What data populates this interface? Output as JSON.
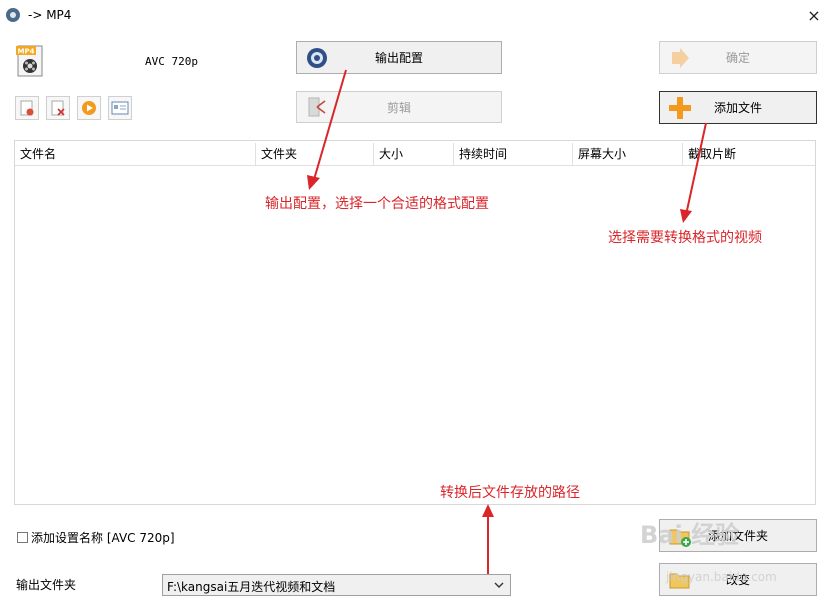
{
  "window": {
    "title": "-> MP4",
    "close": "×"
  },
  "preset": {
    "name": "AVC 720p"
  },
  "buttons": {
    "output_config": "输出配置",
    "ok": "确定",
    "edit": "剪辑",
    "add_file": "添加文件",
    "add_folder": "添加文件夹",
    "change": "改变"
  },
  "table": {
    "columns": [
      "文件名",
      "文件夹",
      "大小",
      "持续时间",
      "屏幕大小",
      "截取片断"
    ]
  },
  "annotations": {
    "output_config": "输出配置，选择一个合适的格式配置",
    "select_video": "选择需要转换格式的视频",
    "output_path": "转换后文件存放的路径"
  },
  "bottom": {
    "checkbox_label": "添加设置名称 [AVC 720p]",
    "output_folder_label": "输出文件夹",
    "output_folder_value": "F:\\kangsai五月迭代视频和文档"
  },
  "watermark": {
    "main": "Bai 经验",
    "sub": "jingyan.baidu.com"
  },
  "colors": {
    "annotation": "#d9262b",
    "plus_orange": "#f39a1e"
  }
}
